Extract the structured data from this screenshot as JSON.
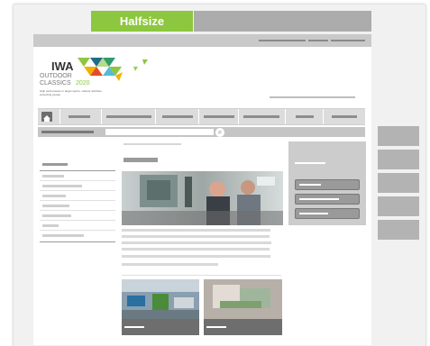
{
  "tabs": {
    "active_label": "Halfsize"
  },
  "logo": {
    "line1": "IWA",
    "line2": "OUTDOOR",
    "line3": "CLASSICS",
    "year": "2020",
    "tagline": "High performance in target sports, outdoor activities, protecting people"
  },
  "search": {
    "icon": "magnifier-icon"
  },
  "colors": {
    "accent": "#8dc63f",
    "frame": "#f1f1f1",
    "placeholder": "#cfcfcf"
  }
}
